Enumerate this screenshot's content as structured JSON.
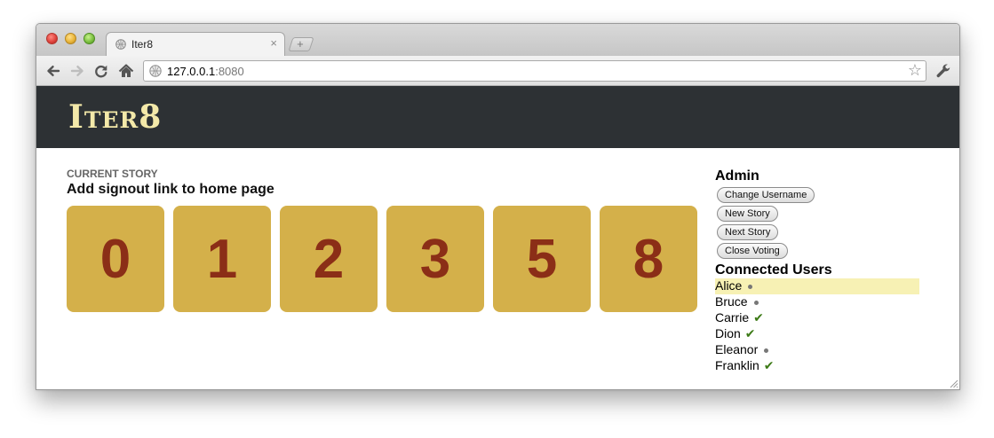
{
  "browser": {
    "tab_title": "Iter8",
    "tab_close_glyph": "×",
    "new_tab_glyph": "+",
    "url_host": "127.0.0.1",
    "url_port": ":8080",
    "bookmark_glyph": "☆"
  },
  "site": {
    "logo": "Iter8"
  },
  "story": {
    "label": "CURRENT STORY",
    "title": "Add signout link to home page"
  },
  "cards": [
    "0",
    "1",
    "2",
    "3",
    "5",
    "8"
  ],
  "admin": {
    "heading": "Admin",
    "buttons": [
      "Change Username",
      "New Story",
      "Next Story",
      "Close Voting"
    ]
  },
  "users": {
    "heading": "Connected Users",
    "list": [
      {
        "name": "Alice",
        "voted": false,
        "current": true
      },
      {
        "name": "Bruce",
        "voted": false,
        "current": false
      },
      {
        "name": "Carrie",
        "voted": true,
        "current": false
      },
      {
        "name": "Dion",
        "voted": true,
        "current": false
      },
      {
        "name": "Eleanor",
        "voted": false,
        "current": false
      },
      {
        "name": "Franklin",
        "voted": true,
        "current": false
      }
    ],
    "voted_glyph": "✔"
  },
  "colors": {
    "header_bg": "#2d3134",
    "logo": "#f4e9a9",
    "card_bg": "#d4b04a",
    "card_text": "#8b2e17",
    "check": "#3c7a16",
    "current_user_highlight": "#f7f1b4"
  },
  "icons": [
    "back-arrow-icon",
    "forward-arrow-icon",
    "reload-icon",
    "home-icon",
    "globe-icon",
    "star-icon",
    "wrench-icon",
    "resize-grip-icon"
  ]
}
